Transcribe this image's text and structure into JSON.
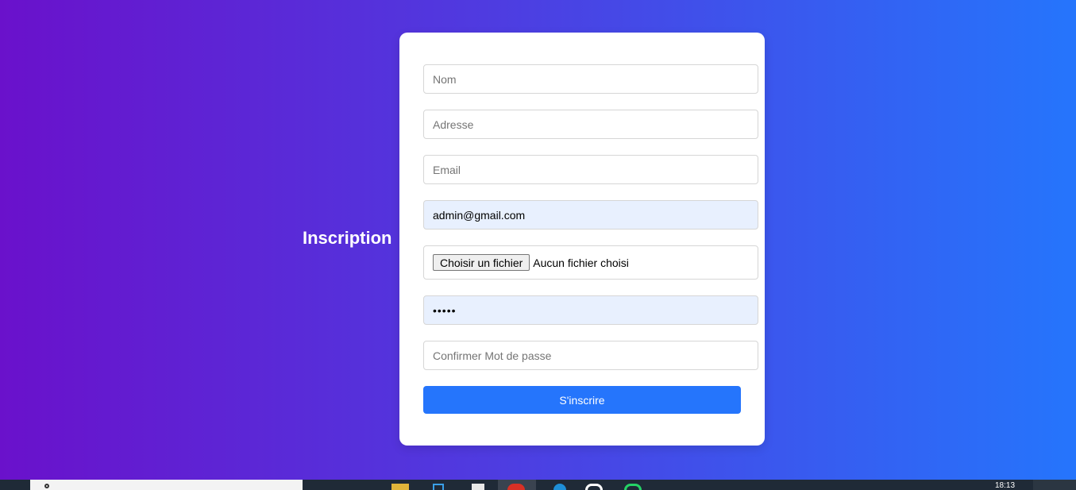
{
  "page": {
    "heading": "Inscription"
  },
  "form": {
    "nom_placeholder": "Nom",
    "adresse_placeholder": "Adresse",
    "email_placeholder": "Email",
    "email2_value": "admin@gmail.com",
    "file_button_label": "Choisir un fichier",
    "file_status": "Aucun fichier choisi",
    "password_value": "•••••",
    "confirm_placeholder": "Confirmer Mot de passe",
    "submit_label": "S'inscrire"
  },
  "taskbar": {
    "time": "18:13"
  },
  "colors": {
    "gradient_start": "#6a11cb",
    "gradient_end": "#2575fc",
    "button": "#2575fc",
    "autofill": "#e8f0fe"
  }
}
